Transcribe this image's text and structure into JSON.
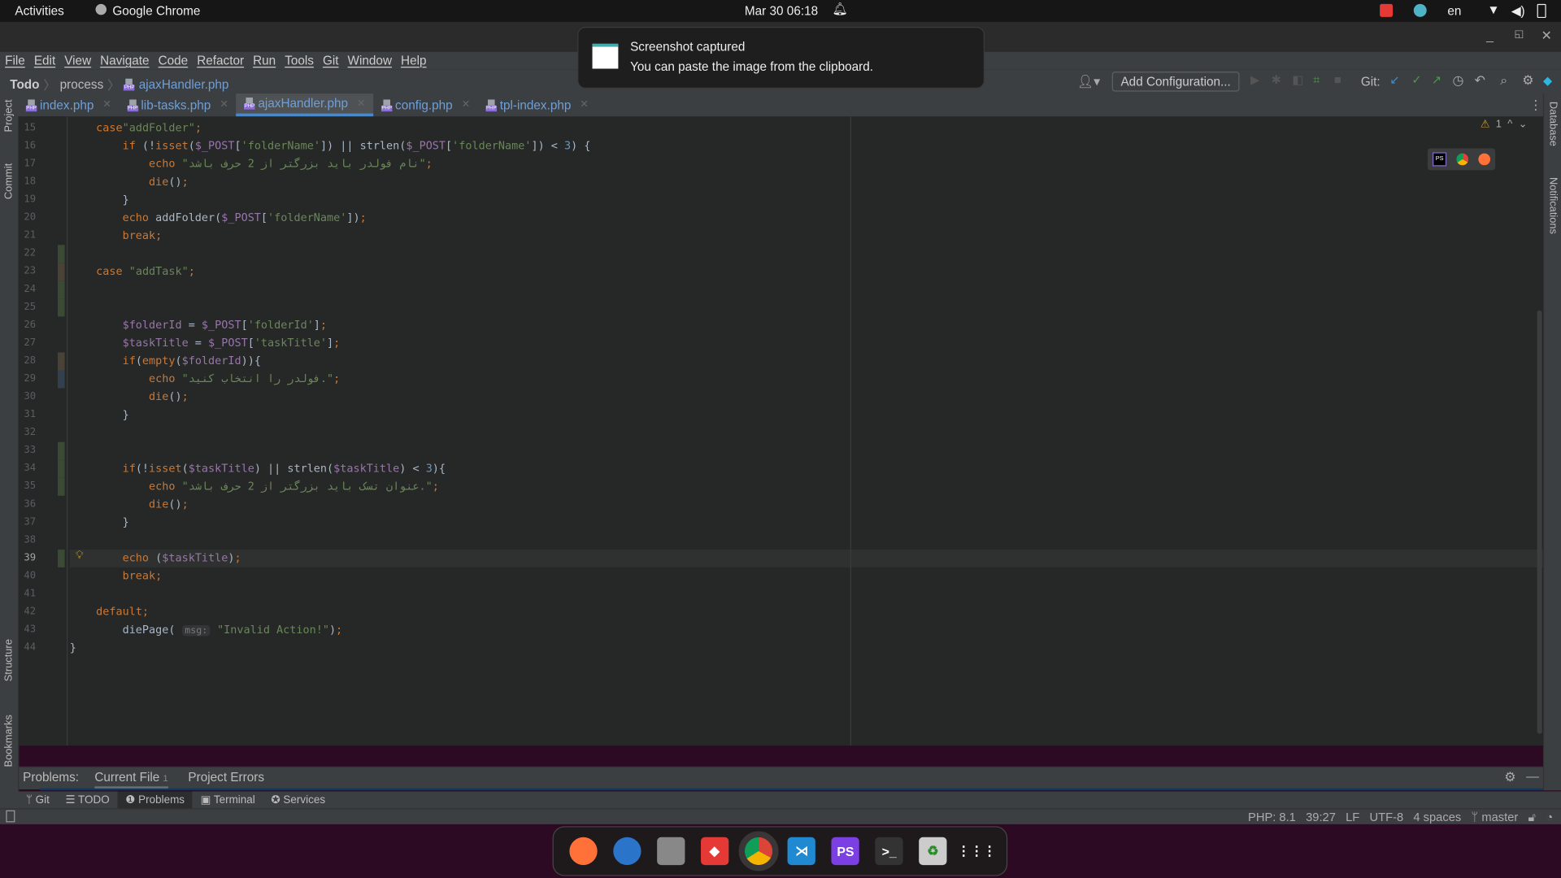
{
  "topbar": {
    "activities": "Activities",
    "app": "Google Chrome",
    "datetime": "Mar 30  06:18",
    "lang": "en"
  },
  "notification": {
    "title": "Screenshot captured",
    "body": "You can paste the image from the clipboard."
  },
  "menu": [
    "File",
    "Edit",
    "View",
    "Navigate",
    "Code",
    "Refactor",
    "Run",
    "Tools",
    "Git",
    "Window",
    "Help"
  ],
  "breadcrumb": [
    "Todo",
    "process",
    "ajaxHandler.php"
  ],
  "toolbar": {
    "add_config": "Add Configuration...",
    "git_label": "Git:"
  },
  "tabs": [
    {
      "label": "index.php",
      "active": false
    },
    {
      "label": "lib-tasks.php",
      "active": false
    },
    {
      "label": "ajaxHandler.php",
      "active": true
    },
    {
      "label": "config.php",
      "active": false
    },
    {
      "label": "tpl-index.php",
      "active": false
    }
  ],
  "left_panels": [
    "Project",
    "Commit",
    "Structure",
    "Bookmarks"
  ],
  "right_panels": [
    "Database",
    "Notifications"
  ],
  "inspections": {
    "warnings": "1"
  },
  "editor": {
    "current_line": 39,
    "lines": [
      {
        "n": "15",
        "t": [
          [
            "",
            "    "
          ],
          [
            "kw",
            "case"
          ],
          [
            "str",
            "\"addFolder\""
          ],
          [
            "kw",
            ";"
          ]
        ]
      },
      {
        "n": "16",
        "t": [
          [
            "",
            "        "
          ],
          [
            "kw",
            "if "
          ],
          [
            "pl",
            "(!"
          ],
          [
            "kw",
            "isset"
          ],
          [
            "pl",
            "("
          ],
          [
            "var",
            "$_POST"
          ],
          [
            "pl",
            "["
          ],
          [
            "str",
            "'folderName'"
          ],
          [
            "pl",
            "]) || strlen("
          ],
          [
            "var",
            "$_POST"
          ],
          [
            "pl",
            "["
          ],
          [
            "str",
            "'folderName'"
          ],
          [
            "pl",
            "]) < "
          ],
          [
            "num",
            "3"
          ],
          [
            "pl",
            ") {"
          ]
        ]
      },
      {
        "n": "17",
        "t": [
          [
            "",
            "            "
          ],
          [
            "kw",
            "echo "
          ],
          [
            "str",
            "\"نام فولدر باید بزرگتر از 2 حرف باشد\""
          ],
          [
            "kw",
            ";"
          ]
        ]
      },
      {
        "n": "18",
        "t": [
          [
            "",
            "            "
          ],
          [
            "kw",
            "die"
          ],
          [
            "pl",
            "()"
          ],
          [
            "kw",
            ";"
          ]
        ]
      },
      {
        "n": "19",
        "t": [
          [
            "",
            "        "
          ],
          [
            "pl",
            "}"
          ]
        ]
      },
      {
        "n": "20",
        "t": [
          [
            "",
            "        "
          ],
          [
            "kw",
            "echo "
          ],
          [
            "pl",
            "addFolder("
          ],
          [
            "var",
            "$_POST"
          ],
          [
            "pl",
            "["
          ],
          [
            "str",
            "'folderName'"
          ],
          [
            "pl",
            "])"
          ],
          [
            "kw",
            ";"
          ]
        ]
      },
      {
        "n": "21",
        "t": [
          [
            "",
            "        "
          ],
          [
            "kw",
            "break;"
          ]
        ]
      },
      {
        "n": "22",
        "t": []
      },
      {
        "n": "23",
        "t": [
          [
            "",
            "    "
          ],
          [
            "kw",
            "case "
          ],
          [
            "str",
            "\"addTask\""
          ],
          [
            "kw",
            ";"
          ]
        ]
      },
      {
        "n": "24",
        "t": []
      },
      {
        "n": "25",
        "t": []
      },
      {
        "n": "26",
        "t": [
          [
            "",
            "        "
          ],
          [
            "var",
            "$folderId"
          ],
          [
            "pl",
            " = "
          ],
          [
            "var",
            "$_POST"
          ],
          [
            "pl",
            "["
          ],
          [
            "str",
            "'folderId'"
          ],
          [
            "pl",
            "]"
          ],
          [
            "kw",
            ";"
          ]
        ]
      },
      {
        "n": "27",
        "t": [
          [
            "",
            "        "
          ],
          [
            "var",
            "$taskTitle"
          ],
          [
            "pl",
            " = "
          ],
          [
            "var",
            "$_POST"
          ],
          [
            "pl",
            "["
          ],
          [
            "str",
            "'taskTitle'"
          ],
          [
            "pl",
            "]"
          ],
          [
            "kw",
            ";"
          ]
        ]
      },
      {
        "n": "28",
        "t": [
          [
            "",
            "        "
          ],
          [
            "kw",
            "if"
          ],
          [
            "pl",
            "("
          ],
          [
            "kw",
            "empty"
          ],
          [
            "pl",
            "("
          ],
          [
            "var",
            "$folderId"
          ],
          [
            "pl",
            ")){"
          ]
        ]
      },
      {
        "n": "29",
        "t": [
          [
            "",
            "            "
          ],
          [
            "kw",
            "echo "
          ],
          [
            "str",
            "\".فولدر را انتخاب کنید\""
          ],
          [
            "kw",
            ";"
          ]
        ]
      },
      {
        "n": "30",
        "t": [
          [
            "",
            "            "
          ],
          [
            "kw",
            "die"
          ],
          [
            "pl",
            "()"
          ],
          [
            "kw",
            ";"
          ]
        ]
      },
      {
        "n": "31",
        "t": [
          [
            "",
            "        "
          ],
          [
            "pl",
            "}"
          ]
        ]
      },
      {
        "n": "32",
        "t": []
      },
      {
        "n": "33",
        "t": []
      },
      {
        "n": "34",
        "t": [
          [
            "",
            "        "
          ],
          [
            "kw",
            "if"
          ],
          [
            "pl",
            "(!"
          ],
          [
            "kw",
            "isset"
          ],
          [
            "pl",
            "("
          ],
          [
            "var",
            "$taskTitle"
          ],
          [
            "pl",
            ") || strlen("
          ],
          [
            "var",
            "$taskTitle"
          ],
          [
            "pl",
            ") < "
          ],
          [
            "num",
            "3"
          ],
          [
            "pl",
            "){"
          ]
        ]
      },
      {
        "n": "35",
        "t": [
          [
            "",
            "            "
          ],
          [
            "kw",
            "echo "
          ],
          [
            "str",
            "\".عنوان تسک باید بزرگتر از 2 حرف باشد\""
          ],
          [
            "kw",
            ";"
          ]
        ]
      },
      {
        "n": "36",
        "t": [
          [
            "",
            "            "
          ],
          [
            "kw",
            "die"
          ],
          [
            "pl",
            "()"
          ],
          [
            "kw",
            ";"
          ]
        ]
      },
      {
        "n": "37",
        "t": [
          [
            "",
            "        "
          ],
          [
            "pl",
            "}"
          ]
        ]
      },
      {
        "n": "38",
        "t": []
      },
      {
        "n": "39",
        "t": [
          [
            "",
            "        "
          ],
          [
            "kw",
            "echo "
          ],
          [
            "pl",
            "("
          ],
          [
            "var",
            "$taskTitle"
          ],
          [
            "pl",
            ")"
          ],
          [
            "kw",
            ";"
          ]
        ]
      },
      {
        "n": "40",
        "t": [
          [
            "",
            "        "
          ],
          [
            "kw",
            "break;"
          ]
        ]
      },
      {
        "n": "41",
        "t": []
      },
      {
        "n": "42",
        "t": [
          [
            "",
            "    "
          ],
          [
            "kw",
            "default;"
          ]
        ]
      },
      {
        "n": "43",
        "t": [
          [
            "",
            "        "
          ],
          [
            "pl",
            "diePage( "
          ],
          [
            "hint",
            "msg:"
          ],
          [
            "str",
            " \"Invalid Action!\""
          ],
          [
            "pl",
            ")"
          ],
          [
            "kw",
            ";"
          ]
        ]
      },
      {
        "n": "44",
        "t": [
          [
            "pl",
            "}"
          ]
        ]
      }
    ]
  },
  "problems": {
    "label": "Problems:",
    "tabs": [
      {
        "label": "Current File",
        "count": "1"
      },
      {
        "label": "Project Errors"
      }
    ]
  },
  "bottom_tabs": [
    {
      "label": "Git",
      "icon": "branch-icon"
    },
    {
      "label": "TODO",
      "icon": "list-icon"
    },
    {
      "label": "Problems",
      "icon": "warning-icon",
      "active": true
    },
    {
      "label": "Terminal",
      "icon": "terminal-icon"
    },
    {
      "label": "Services",
      "icon": "services-icon"
    }
  ],
  "status": {
    "php": "PHP: 8.1",
    "position": "39:27",
    "line_sep": "LF",
    "encoding": "UTF-8",
    "indent": "4 spaces",
    "branch": "master"
  },
  "dock": [
    "firefox",
    "thunderbird",
    "files",
    "anydesk",
    "chrome",
    "vscode",
    "phpstorm",
    "terminal",
    "trash",
    "apps"
  ],
  "colors": {
    "keyword": "#cc7832",
    "string": "#6a8759",
    "variable": "#9876aa",
    "number": "#6897bb",
    "link": "#6f9fd8"
  }
}
